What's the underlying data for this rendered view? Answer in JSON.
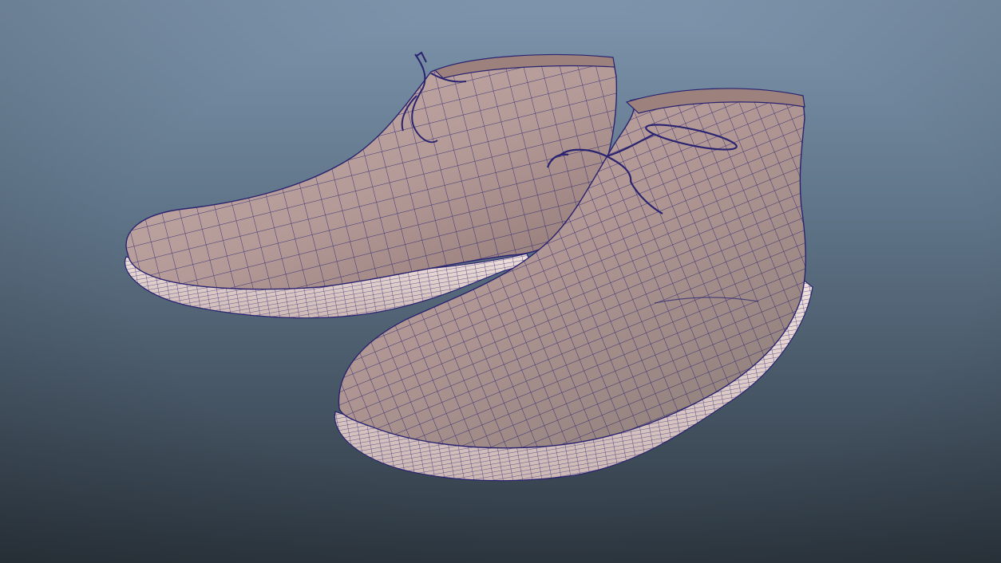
{
  "viewport": {
    "background_top": "#7e95ad",
    "background_bottom": "#2e3841",
    "wireframe_color": "#2a2370",
    "shoe_color": "#b49a97",
    "shoe_highlight": "#c8b0ab",
    "shoe_shadow": "#8d7572",
    "sole_color": "#e3d0cc",
    "object_names": [
      "boot-left",
      "boot-right"
    ]
  }
}
